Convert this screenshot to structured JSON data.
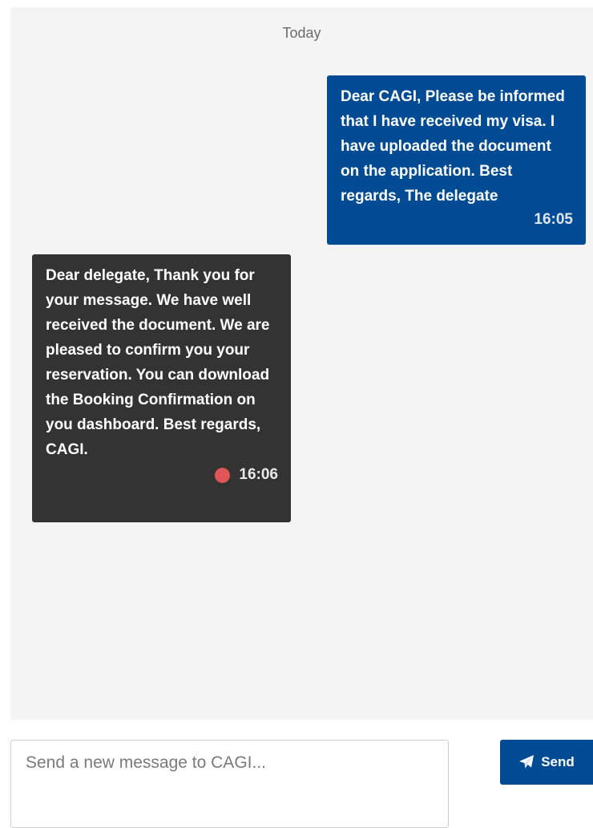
{
  "chat": {
    "date_divider": "Today",
    "messages": [
      {
        "direction": "sent",
        "text": "Dear CAGI, Please be informed that I have received my visa. I have uploaded the document on the application. Best regards, The delegate",
        "time": "16:05"
      },
      {
        "direction": "received",
        "text": "Dear delegate, Thank you for your message. We have well received the document. We are pleased to confirm you your reservation. You can download the Booking Confirmation on you dashboard. Best regards, CAGI.",
        "time": "16:06",
        "status_dot_color": "#e05555"
      }
    ]
  },
  "composer": {
    "placeholder": "Send a new message to CAGI...",
    "value": "",
    "send_label": "Send",
    "send_icon": "paper-plane-icon"
  },
  "colors": {
    "sent_bubble": "#004b93",
    "received_bubble": "#333333",
    "panel_background": "#f4f4f4",
    "accent": "#004b93"
  }
}
